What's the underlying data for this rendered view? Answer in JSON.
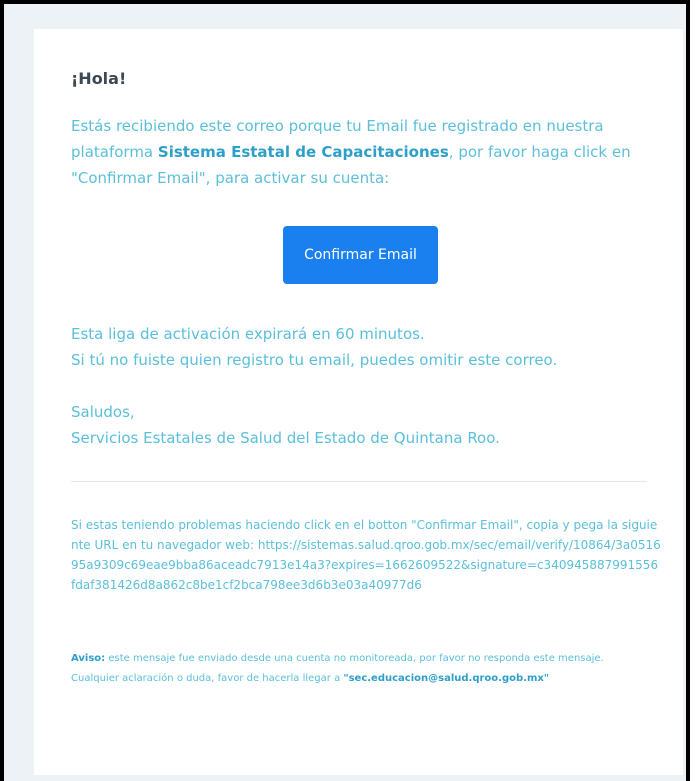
{
  "email": {
    "greeting": "¡Hola!",
    "intro_before": "Estás recibiendo este correo porque tu Email fue registrado en nuestra plataforma ",
    "platform_name": "Sistema Estatal de Capacitaciones",
    "intro_after": ", por favor haga click en \"Confirmar Email\", para activar su cuenta:",
    "button_label": "Confirmar Email",
    "expiry_line": "Esta liga de activación expirará en 60 minutos.",
    "ignore_line": "Si tú no fuiste quien registro tu email, puedes omitir este correo.",
    "salutation": "Saludos,",
    "sender": "Servicios Estatales de Salud del Estado de Quintana Roo.",
    "subcopy_text": "Si estas teniendo problemas haciendo click en el botton \"Confirmar Email\", copia y pega la siguiente URL en tu navegador web:",
    "verify_url": "https://sistemas.salud.qroo.gob.mx/sec/email/verify/10864/3a051695a9309c69eae9bba86aceadc7913e14a3?expires=1662609522&signature=c340945887991556fdaf381426d8a862c8be1cf2bca798ee3d6b3e03a40977d6",
    "notice_label": "Aviso:",
    "notice_text": " este mensaje fue enviado desde una cuenta no monitoreada, por favor no responda este mensaje.",
    "contact_text": "Cualquier aclaración o duda, favor de hacerla llegar a ",
    "contact_email": "\"sec.educacion@salud.qroo.gob.mx\""
  }
}
